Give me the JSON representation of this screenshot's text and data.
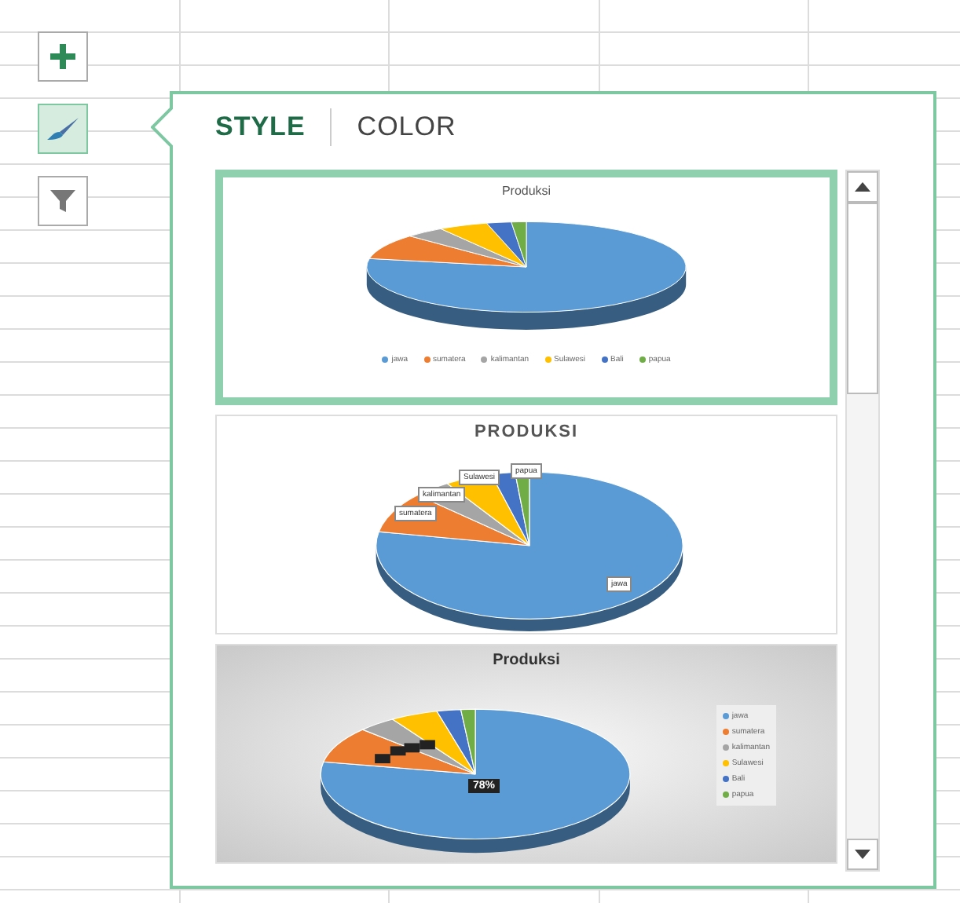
{
  "side_buttons": [
    {
      "selected": false
    },
    {
      "selected": true
    },
    {
      "selected": false
    }
  ],
  "tabs": [
    {
      "label": "STYLE",
      "selected": true
    },
    {
      "label": "COLOR",
      "selected": false
    }
  ],
  "styles": [
    {
      "kind": "legend-bottom",
      "title": "Produksi",
      "selected": true,
      "series": [
        {
          "name": "jawa",
          "color": "#5b9bd5"
        },
        {
          "name": "sumatera",
          "color": "#ed7d31"
        },
        {
          "name": "kalimantan",
          "color": "#a5a5a5"
        },
        {
          "name": "Sulawesi",
          "color": "#ffc000"
        },
        {
          "name": "Bali",
          "color": "#4472c4"
        },
        {
          "name": "papua",
          "color": "#70ad47"
        }
      ]
    },
    {
      "kind": "callouts",
      "title": "PRODUKSI",
      "selected": false,
      "callouts": [
        {
          "label": "papua"
        },
        {
          "label": "Sulawesi"
        },
        {
          "label": "kalimantan"
        },
        {
          "label": "sumatera"
        },
        {
          "label": "jawa"
        }
      ]
    },
    {
      "kind": "legend-right",
      "title": "Produksi",
      "selected": false,
      "data_label": "78%",
      "series": [
        {
          "name": "jawa",
          "color": "#5b9bd5"
        },
        {
          "name": "sumatera",
          "color": "#ed7d31"
        },
        {
          "name": "kalimantan",
          "color": "#a5a5a5"
        },
        {
          "name": "Sulawesi",
          "color": "#ffc000"
        },
        {
          "name": "Bali",
          "color": "#4472c4"
        },
        {
          "name": "papua",
          "color": "#70ad47"
        }
      ]
    }
  ]
}
